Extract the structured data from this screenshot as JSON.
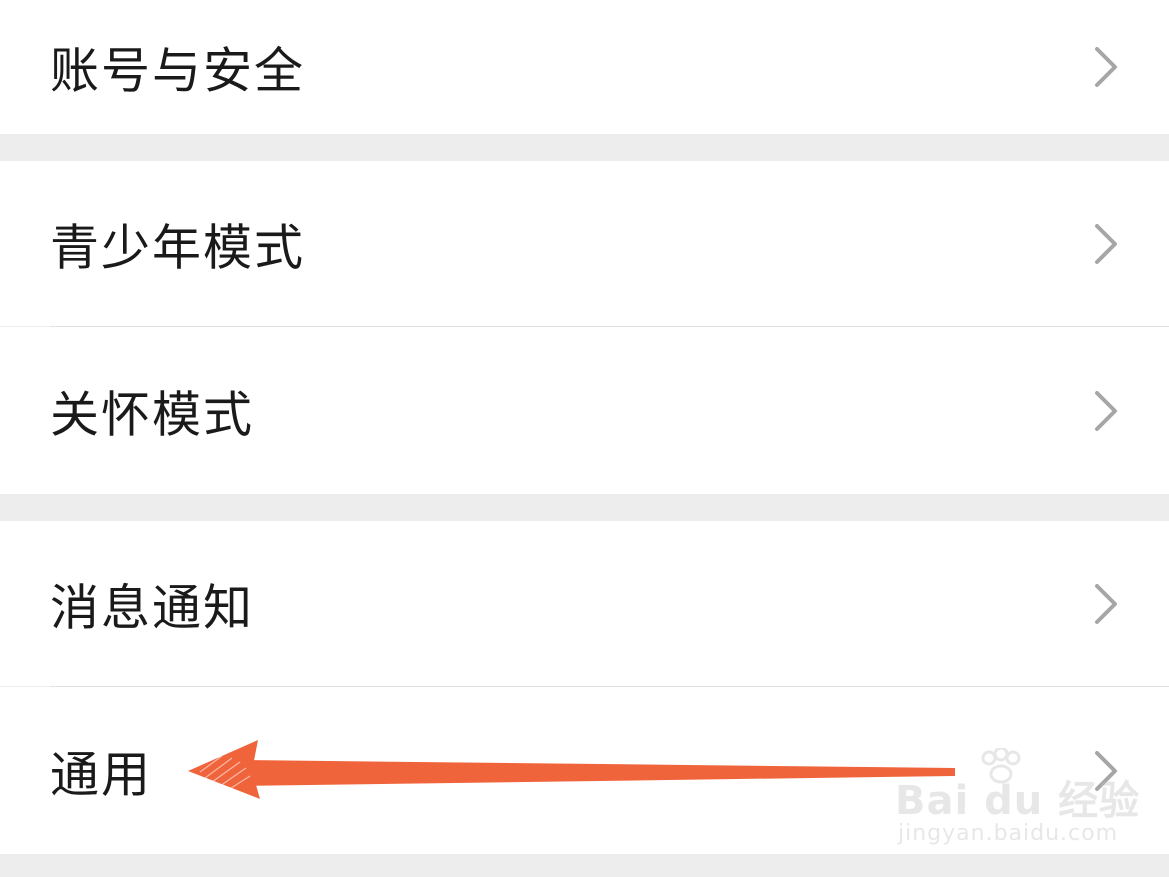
{
  "settings": {
    "items": [
      {
        "label": "账号与安全",
        "icon": "chevron-right-icon"
      },
      {
        "label": "青少年模式",
        "icon": "chevron-right-icon"
      },
      {
        "label": "关怀模式",
        "icon": "chevron-right-icon"
      },
      {
        "label": "消息通知",
        "icon": "chevron-right-icon"
      },
      {
        "label": "通用",
        "icon": "chevron-right-icon"
      }
    ]
  },
  "annotation": {
    "color": "#f0643c",
    "icon": "arrow-left-icon",
    "target": "通用"
  },
  "watermark": {
    "brand": "Bai du 经验",
    "url": "jingyan.baidu.com"
  },
  "colors": {
    "background": "#ededed",
    "row": "#ffffff",
    "text": "#1a1a1a",
    "chevron": "#a6a6a6",
    "separator": "#e2e2e2"
  }
}
